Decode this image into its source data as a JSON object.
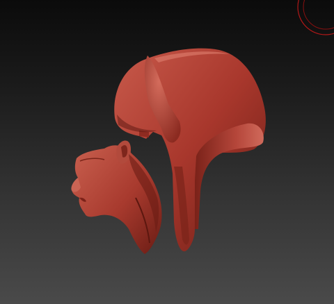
{
  "app": {
    "kind": "3d-sculpting-viewport"
  },
  "viewport": {
    "background_top": "#0b0b0b",
    "background_bottom": "#4a4a4a"
  },
  "gizmo": {
    "icon": "rotation-gizmo-icon",
    "color": "#b01818"
  },
  "model": {
    "material_color": "#a8372c",
    "highlight_color": "#d3695a",
    "shadow_color": "#5a160f",
    "parts": [
      {
        "name": "head-piece"
      },
      {
        "name": "headdress-shell"
      }
    ]
  }
}
